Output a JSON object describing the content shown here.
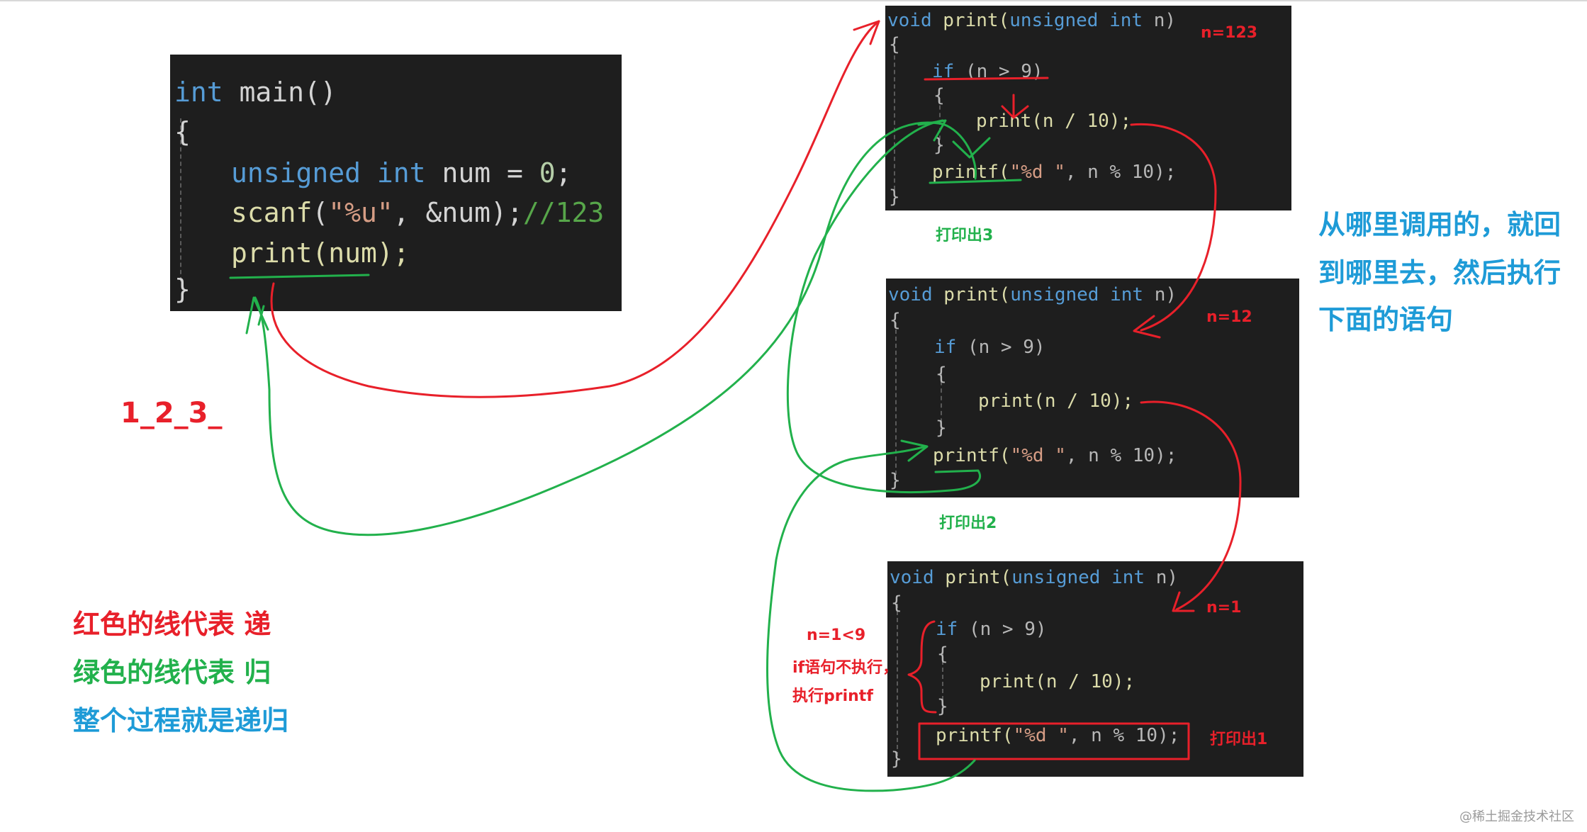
{
  "main_code": {
    "line1_kw": "int",
    "line1_rest": " main()",
    "brace_open": "{",
    "line3_kw1": "unsigned",
    "line3_kw2": "int",
    "line3_rest": " num = ",
    "line3_num": "0",
    "line3_end": ";",
    "line4_fn": "scanf",
    "line4_open": "(",
    "line4_str": "\"%u\"",
    "line4_args": ", &num);",
    "line4_cmt": "//123",
    "line5": "print(num);",
    "brace_close": "}"
  },
  "func_code": {
    "void": "void",
    "name": " print(",
    "unsigned": "unsigned",
    "int": "int",
    "param": " n)",
    "brace_open": "{",
    "if_kw": "if",
    "if_cond": " (n > 9)",
    "inner_open": "{",
    "recursive_call": "print(n / 10);",
    "inner_close": "}",
    "printf_fn": "printf(",
    "printf_str": "\"%d \"",
    "printf_args": ", n % 10);",
    "brace_close": "}"
  },
  "annotations": {
    "n123": "n=123",
    "n12": "n=12",
    "n1": "n=1",
    "print3": "打印出3",
    "print2": "打印出2",
    "print1": "打印出1",
    "output": "1_2_3_",
    "cond_line1": "n=1<9",
    "cond_line2": "if语句不执行，",
    "cond_line3": "执行printf",
    "return_note_line1": "从哪里调用的，就回",
    "return_note_line2": "到哪里去，然后执行",
    "return_note_line3": "下面的语句",
    "legend_red": "红色的线代表 递",
    "legend_green": "绿色的线代表 归",
    "legend_blue": "整个过程就是递归",
    "watermark": "@稀土掘金技术社区"
  },
  "colors": {
    "red": "#e8202a",
    "green": "#22b14c",
    "blue": "#1e9bd7",
    "code_bg": "#1e1e1e"
  }
}
